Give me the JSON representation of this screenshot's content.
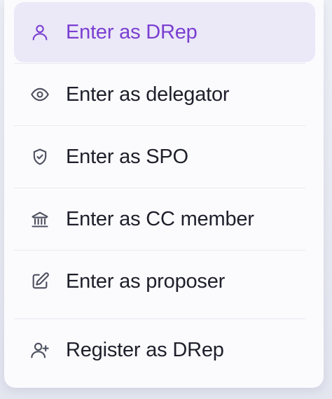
{
  "menu": {
    "items": [
      {
        "label": "Enter as DRep",
        "icon": "user-icon",
        "active": true
      },
      {
        "label": "Enter as delegator",
        "icon": "eye-icon",
        "active": false
      },
      {
        "label": "Enter as SPO",
        "icon": "shield-check-icon",
        "active": false
      },
      {
        "label": "Enter as CC member",
        "icon": "bank-icon",
        "active": false
      },
      {
        "label": "Enter as proposer",
        "icon": "edit-icon",
        "active": false
      },
      {
        "label": "Register as DRep",
        "icon": "user-plus-icon",
        "active": false
      }
    ]
  },
  "colors": {
    "accent": "#7a3fd1",
    "active_bg": "#ebe8f8",
    "text": "#1e1f2a",
    "icon": "#4c4f5e"
  }
}
